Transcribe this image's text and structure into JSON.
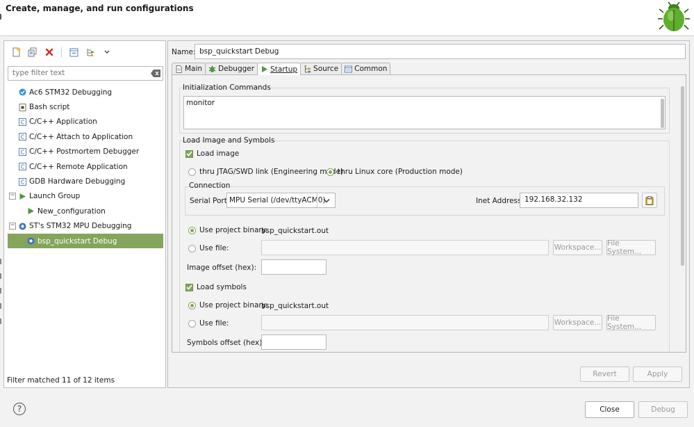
{
  "header": {
    "title": "Create, manage, and run configurations",
    "logo_icon": "bug-icon"
  },
  "left_panel": {
    "toolbar": [
      {
        "name": "new-config-icon"
      },
      {
        "name": "duplicate-icon"
      },
      {
        "name": "delete-icon"
      },
      {
        "name": "collapse-all-icon"
      },
      {
        "name": "filter-icon"
      },
      {
        "name": "dropdown-icon"
      }
    ],
    "filter": {
      "placeholder": "type filter text",
      "value": ""
    },
    "tree": [
      {
        "label": "Ac6 STM32 Debugging",
        "icon": "ac6-debug-icon",
        "level": 0
      },
      {
        "label": "Bash script",
        "icon": "bash-icon",
        "level": 0
      },
      {
        "label": "C/C++ Application",
        "icon": "c-app-icon",
        "level": 0
      },
      {
        "label": "C/C++ Attach to Application",
        "icon": "c-app-icon",
        "level": 0
      },
      {
        "label": "C/C++ Postmortem Debugger",
        "icon": "c-app-icon",
        "level": 0
      },
      {
        "label": "C/C++ Remote Application",
        "icon": "c-app-icon",
        "level": 0
      },
      {
        "label": "GDB Hardware Debugging",
        "icon": "c-app-icon",
        "level": 0
      },
      {
        "label": "Launch Group",
        "icon": "launch-group-icon",
        "level": 0,
        "expander": "−"
      },
      {
        "label": "New_configuration",
        "icon": "launch-group-icon",
        "level": 1
      },
      {
        "label": "ST's STM32 MPU Debugging",
        "icon": "st-debug-icon",
        "level": 0,
        "expander": "−"
      },
      {
        "label": "bsp_quickstart Debug",
        "icon": "st-debug-icon",
        "level": 1,
        "selected": true
      }
    ],
    "status": "Filter matched 11 of 12 items"
  },
  "right_panel": {
    "name_label": "Name:",
    "name_value": "bsp_quickstart Debug",
    "tabs": [
      {
        "label": "Main",
        "icon": "main-tab-icon",
        "active": false
      },
      {
        "label": "Debugger",
        "icon": "debugger-tab-icon",
        "active": false
      },
      {
        "label": "Startup",
        "icon": "startup-tab-icon",
        "active": true
      },
      {
        "label": "Source",
        "icon": "source-tab-icon",
        "active": false
      },
      {
        "label": "Common",
        "icon": "common-tab-icon",
        "active": false
      }
    ],
    "init": {
      "label": "Initialization Commands",
      "value": "monitor"
    },
    "load": {
      "section_label": "Load Image and Symbols",
      "load_image_label": "Load image",
      "load_image_checked": true,
      "mode_jtag": "thru JTAG/SWD link (Engineering mode)",
      "mode_linux": "thru Linux core (Production mode)",
      "connection_label": "Connection",
      "serial_port_label": "Serial Port:",
      "serial_port_value": "MPU Serial (/dev/ttyACM0)",
      "inet_label": "Inet Address:",
      "inet_value": "192.168.32.132",
      "image_use_project_label": "Use project binary:",
      "image_project_binary": "bsp_quickstart.out",
      "image_use_file_label": "Use file:",
      "image_file_value": "",
      "workspace_label": "Workspace...",
      "filesystem_label": "File System...",
      "image_offset_label": "Image offset (hex):",
      "image_offset_value": "",
      "load_symbols_label": "Load symbols",
      "load_symbols_checked": true,
      "symbols_use_project_label": "Use project binary:",
      "symbols_project_binary": "bsp_quickstart.out",
      "symbols_use_file_label": "Use file:",
      "symbols_file_value": "",
      "symbols_offset_label": "Symbols offset (hex):",
      "symbols_offset_value": ""
    },
    "revert_label": "Revert",
    "apply_label": "Apply"
  },
  "footer": {
    "help_symbol": "?",
    "close_label": "Close",
    "debug_label": "Debug"
  },
  "colors": {
    "selection": "#84a55b",
    "accent_green": "#4f9a3a"
  }
}
